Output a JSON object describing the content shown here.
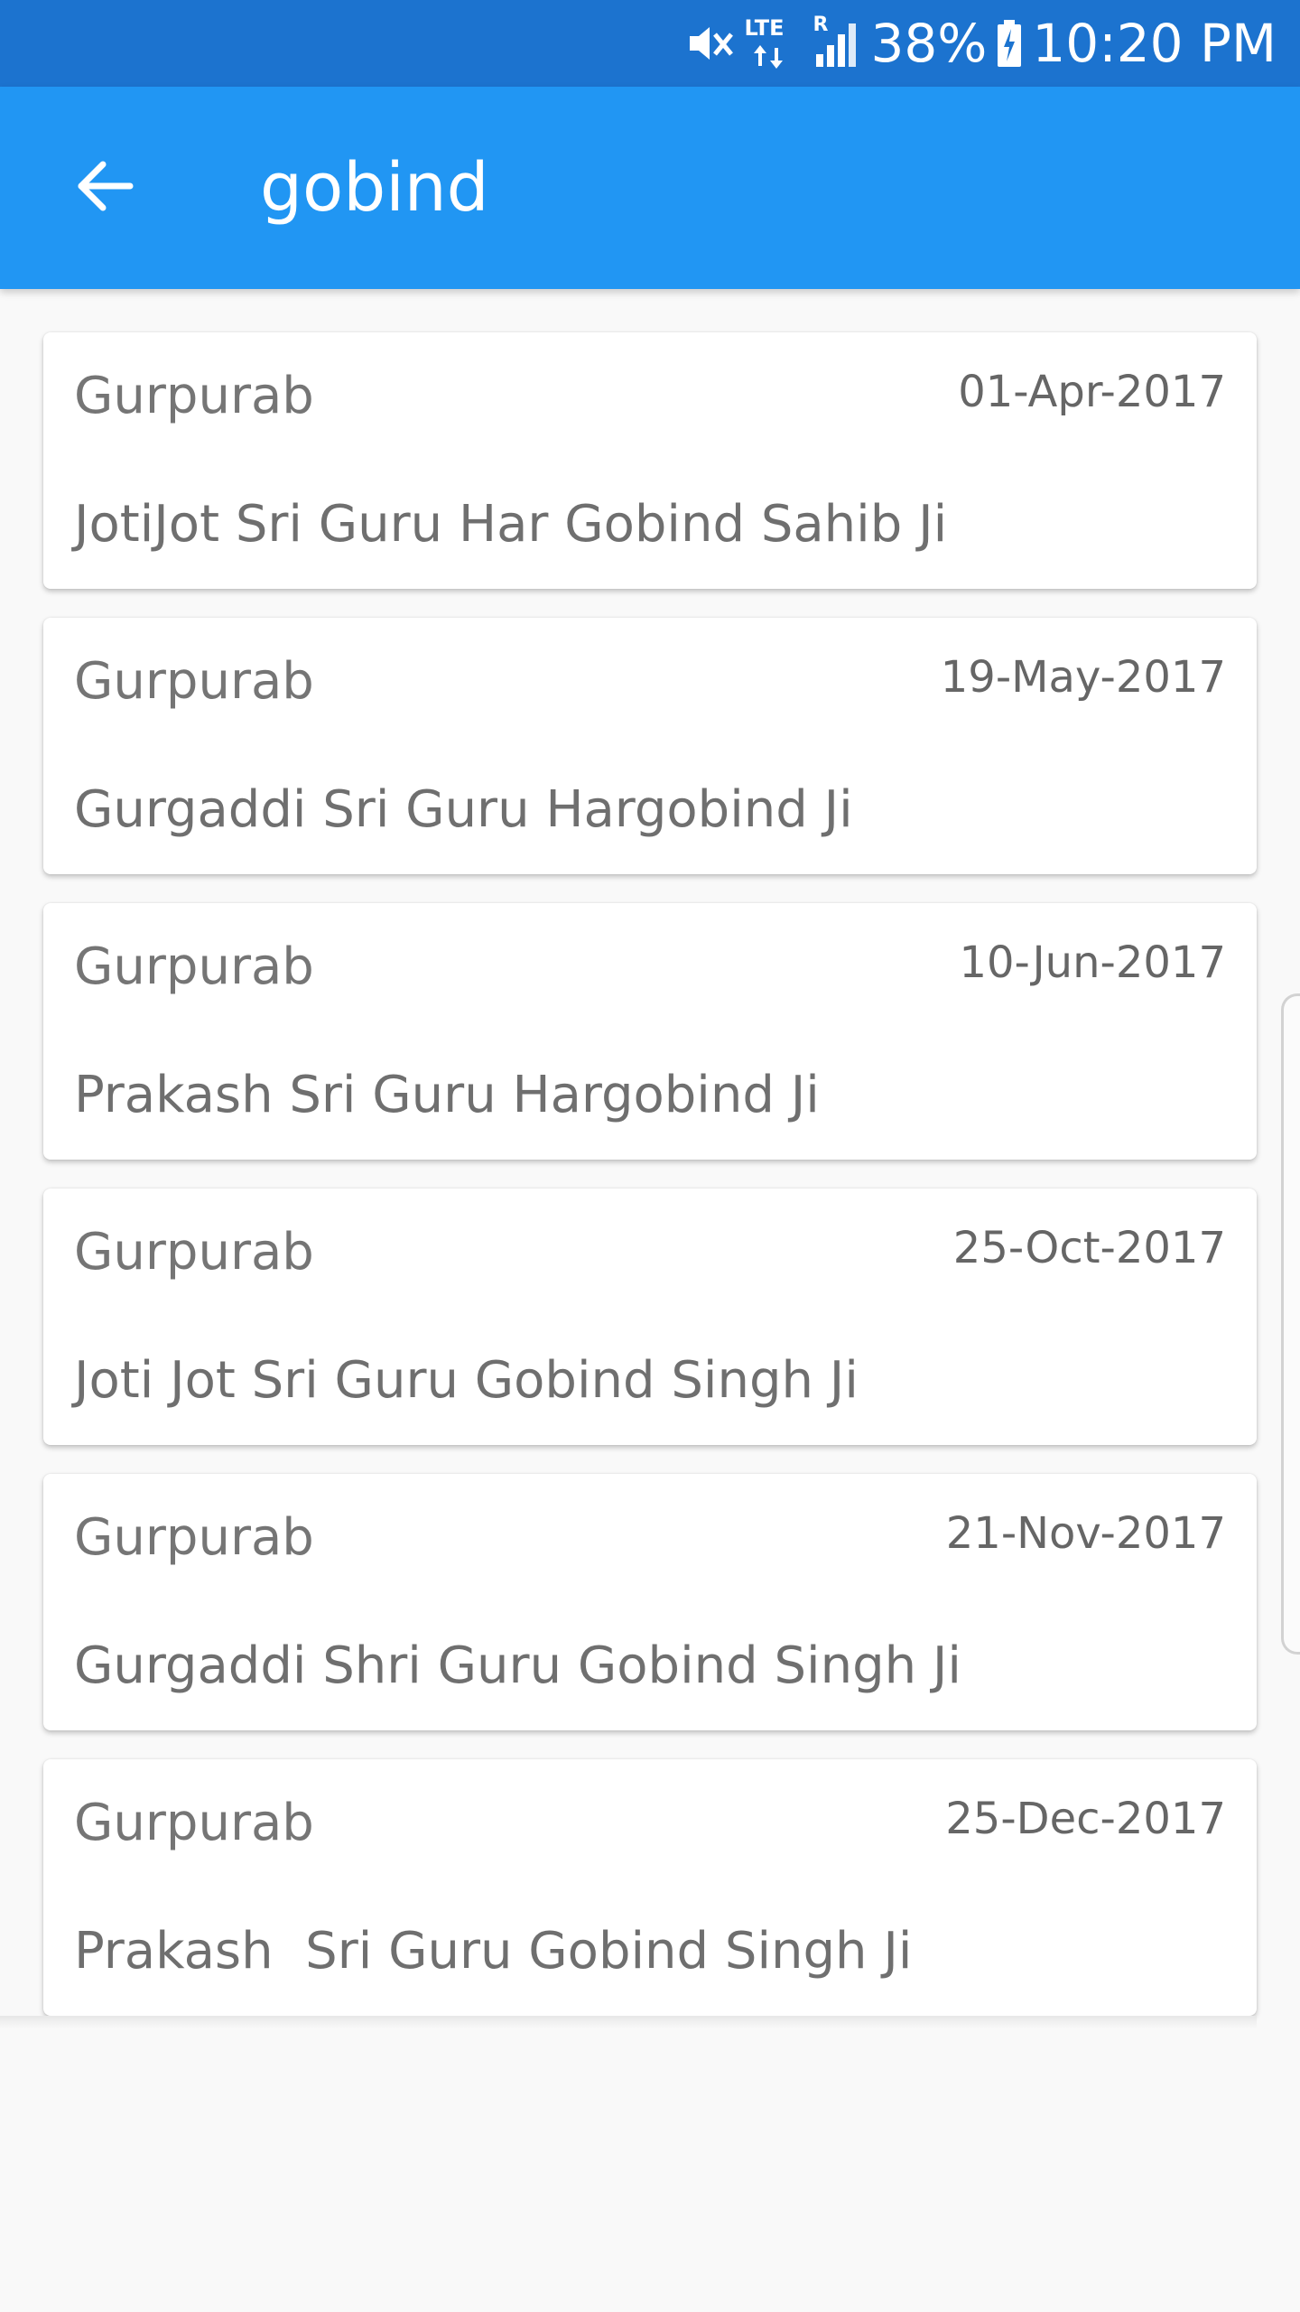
{
  "status_bar": {
    "battery": "38%",
    "time": "10:20 PM",
    "network_label": "LTE",
    "roaming_label": "R",
    "icons": [
      "mute-vibrate-icon",
      "lte-data-icon",
      "signal-icon",
      "battery-charging-icon"
    ]
  },
  "app_bar": {
    "back_icon": "arrow-back-icon",
    "title": "gobind",
    "color": "#2196f3"
  },
  "events": [
    {
      "category": "Gurpurab",
      "date": "01-Apr-2017",
      "title": "JotiJot Sri Guru Har Gobind Sahib Ji"
    },
    {
      "category": "Gurpurab",
      "date": "19-May-2017",
      "title": "Gurgaddi Sri Guru Hargobind Ji"
    },
    {
      "category": "Gurpurab",
      "date": "10-Jun-2017",
      "title": "Prakash Sri Guru Hargobind Ji"
    },
    {
      "category": "Gurpurab",
      "date": "25-Oct-2017",
      "title": "Joti Jot Sri Guru Gobind Singh Ji"
    },
    {
      "category": "Gurpurab",
      "date": "21-Nov-2017",
      "title": "Gurgaddi Shri Guru Gobind Singh Ji"
    },
    {
      "category": "Gurpurab",
      "date": "25-Dec-2017",
      "title": "Prakash  Sri Guru Gobind Singh Ji"
    }
  ]
}
